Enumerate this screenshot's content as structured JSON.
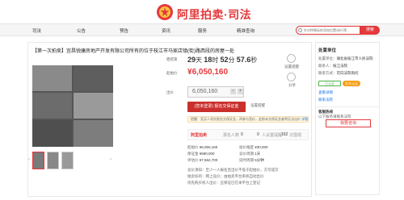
{
  "header": {
    "logo_text": "阿里拍卖·司法",
    "brand_color": "#e4393c"
  },
  "nav": {
    "items": [
      "司法",
      "公告",
      "预告",
      "资讯",
      "服务",
      "精准查询"
    ],
    "search_placeholder": "针对特殊标的添加位置/执行等...",
    "search_button": "搜索"
  },
  "item": {
    "title": "【第一次拍卖】宜昌锐康房地产开发有限公司所有的位于枝江市马家店镇(街)路西段的房屋一处",
    "countdown_label": "距结束",
    "countdown": {
      "days": "29",
      "hours": "18",
      "minutes": "52",
      "seconds": "57.6",
      "d_unit": "天",
      "h_unit": "时",
      "m_unit": "分",
      "s_unit": "秒"
    },
    "start_price_label": "起拍价",
    "start_price": "6,050,160",
    "price_currency": "¥",
    "bid_label": "出价",
    "bid_value": "6,050,160",
    "bid_button": "(您未登录) 报名交保证金",
    "remind_label": "设置提醒",
    "notice": "提醒：竞买人须先报名交保证金，再参与竞价，此前未交保证金者将无法出价",
    "notice_link": "详细",
    "side_icons": [
      {
        "label": "设置提醒"
      },
      {
        "label": "分享"
      }
    ]
  },
  "status": {
    "brand": "阿里拍卖",
    "enrolled_label": "报名人数",
    "enrolled": "0",
    "remind_label": "人设置提醒",
    "remind_count": "0",
    "views_label": "次围观",
    "views": "162"
  },
  "info_rows": [
    {
      "k": "起拍价",
      "v": "¥6,050,160"
    },
    {
      "k": "加价幅度",
      "v": "¥30,000"
    },
    {
      "k": "保证金",
      "v": "¥590,000"
    },
    {
      "k": "竞价周期",
      "v": "1天"
    },
    {
      "k": "评估价",
      "v": "¥7,562,700"
    },
    {
      "k": "延时周期",
      "v": "5分钟"
    }
  ],
  "footer_notes": [
    "竞价须知：至少一人报名且出价不低于起拍价，方可成交",
    "拍卖标的：网上竞价；由拍卖平台系统自动出价",
    "优先购买权人出价：应保证已在本平台上登记"
  ],
  "sidebar": {
    "head": "处置单位",
    "court_label": "处置单位：",
    "court": "湖北省枝江市人民法院",
    "contact_label": "联系人：",
    "contact": "枝江法院",
    "contact2_label": "联系方式：",
    "contact2": "可向法院询问",
    "badges": [
      "已认证",
      "实名认证"
    ],
    "link1": "查看详情",
    "link2": "联系法院",
    "service_label": "客服热线",
    "service": "以下服务请联系法院",
    "button": "我要咨询"
  }
}
